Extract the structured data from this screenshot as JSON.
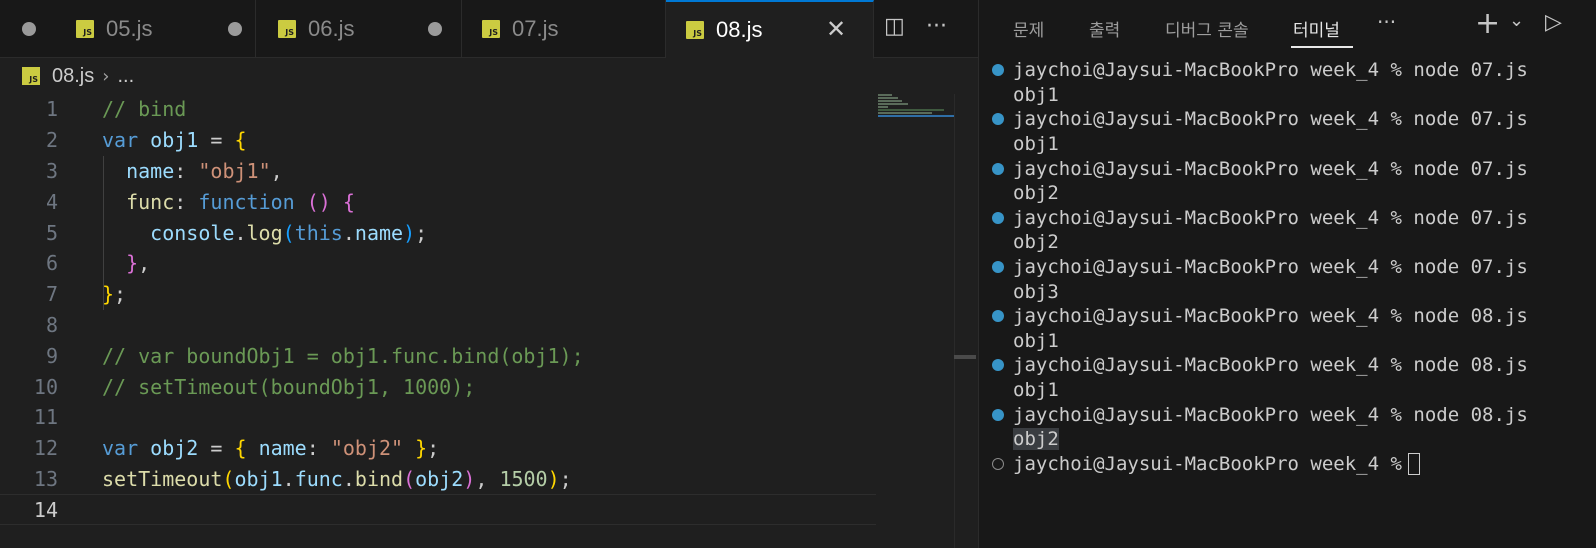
{
  "editor": {
    "tabs": [
      {
        "label": "05.js",
        "dirty": true,
        "active": false
      },
      {
        "label": "06.js",
        "dirty": true,
        "active": false
      },
      {
        "label": "07.js",
        "dirty": false,
        "active": false
      },
      {
        "label": "08.js",
        "dirty": false,
        "active": true
      }
    ],
    "js_icon_text": "JS",
    "close_glyph": "✕",
    "split_glyph": "◫",
    "more_glyph": "···",
    "breadcrumb": {
      "file": "08.js",
      "separator": "›",
      "symbol": "..."
    },
    "line_numbers": [
      "1",
      "2",
      "3",
      "4",
      "5",
      "6",
      "7",
      "8",
      "9",
      "10",
      "11",
      "12",
      "13",
      "14"
    ],
    "current_line": 14
  },
  "panel": {
    "tabs": [
      "문제",
      "출력",
      "디버그 콘솔",
      "터미널"
    ],
    "active_tab": "터미널",
    "more_glyph": "···",
    "add_glyph": "+",
    "dropdown_glyph": "⌄",
    "launch_glyph": "▷"
  },
  "terminal": {
    "prompt": "jaychoi@Jaysui-MacBookPro week_4 % ",
    "runs": [
      {
        "command": "node 07.js",
        "output": "obj1"
      },
      {
        "command": "node 07.js",
        "output": "obj1"
      },
      {
        "command": "node 07.js",
        "output": "obj2"
      },
      {
        "command": "node 07.js",
        "output": "obj2"
      },
      {
        "command": "node 07.js",
        "output": "obj3"
      },
      {
        "command": "node 08.js",
        "output": "obj1"
      },
      {
        "command": "node 08.js",
        "output": "obj1"
      },
      {
        "command": "node 08.js",
        "output": "obj2"
      }
    ],
    "final_prompt": "jaychoi@Jaysui-MacBookPro week_4 %"
  },
  "colors": {
    "accent": "#0078d4",
    "js_icon": "#cbcb41",
    "terminal_mark": "#3794c7"
  }
}
